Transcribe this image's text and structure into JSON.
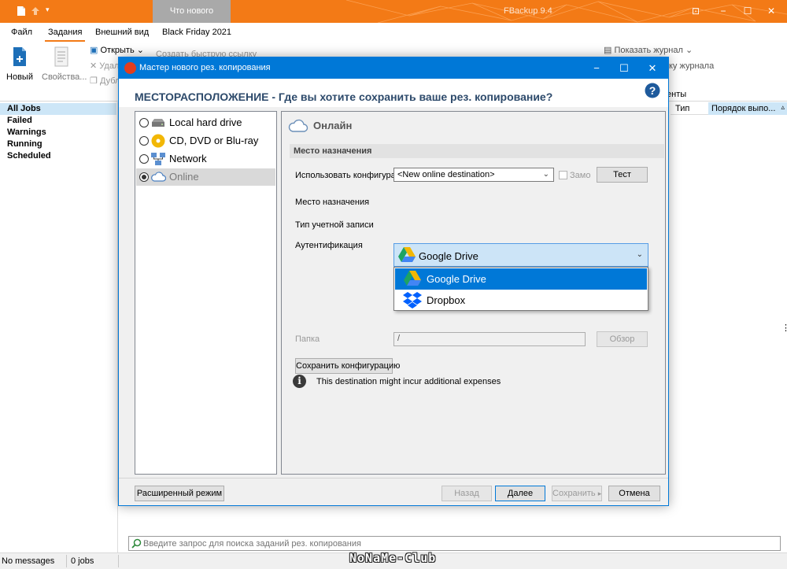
{
  "app": {
    "title": "FBackup 9.4",
    "active_tab": "Что нового",
    "colors": {
      "accent": "#f37a16",
      "selection": "#cde6f7",
      "dialog_accent": "#0078d7"
    }
  },
  "ribbon": {
    "tabs": [
      "Файл",
      "Задания",
      "Внешний вид",
      "Black Friday 2021"
    ],
    "active_tab": "Задания",
    "new_label": "Новый",
    "properties_label": "Свойства...",
    "open_label": "Открыть",
    "delete_label": "Удал",
    "duplicate_label": "Дубл",
    "quick_link_label": "Создать быструю ссылку",
    "show_log_label": "Показать журнал",
    "log_label": "ку журнала",
    "group_label": "енты"
  },
  "sidebar": {
    "items": [
      {
        "label": "All Jobs",
        "selected": true
      },
      {
        "label": "Failed",
        "selected": false
      },
      {
        "label": "Warnings",
        "selected": false
      },
      {
        "label": "Running",
        "selected": false
      },
      {
        "label": "Scheduled",
        "selected": false
      }
    ]
  },
  "list": {
    "columns": [
      "Тип",
      "Порядок выпо..."
    ]
  },
  "search": {
    "placeholder": "Введите запрос для поиска заданий рез. копирования"
  },
  "status": {
    "messages": "No messages",
    "jobs": "0 jobs"
  },
  "watermark": "NoNaMe-Club",
  "dialog": {
    "title": "Мастер нового рез. копирования",
    "heading": "МЕСТОРАСПОЛОЖЕНИЕ - Где вы хотите сохранить ваше рез. копирование?",
    "destinations": [
      {
        "label": "Local hard drive",
        "selected": false,
        "icon": "hard-drive-icon"
      },
      {
        "label": "CD, DVD or Blu-ray",
        "selected": false,
        "icon": "disc-icon"
      },
      {
        "label": "Network",
        "selected": false,
        "icon": "network-icon"
      },
      {
        "label": "Online",
        "selected": true,
        "icon": "cloud-icon"
      }
    ],
    "panel": {
      "title": "Онлайн",
      "section": "Место назначения",
      "use_config_label": "Использовать конфигураци",
      "config_value": "<New online destination>",
      "remember_label": "Замо",
      "test_button": "Тест",
      "destination_label": "Место назначения",
      "destination_value": "Google Drive",
      "destination_options": [
        "Google Drive",
        "Dropbox"
      ],
      "account_type_label": "Тип учетной записи",
      "auth_label": "Аутентификация",
      "folder_label": "Папка",
      "folder_value": "/",
      "browse_button": "Обзор",
      "save_config_button": "Сохранить конфигурацию",
      "info_text": "This destination might incur additional expenses"
    },
    "buttons": {
      "advanced": "Расширенный режим",
      "back": "Назад",
      "next": "Далее",
      "save": "Сохранить",
      "cancel": "Отмена"
    }
  }
}
